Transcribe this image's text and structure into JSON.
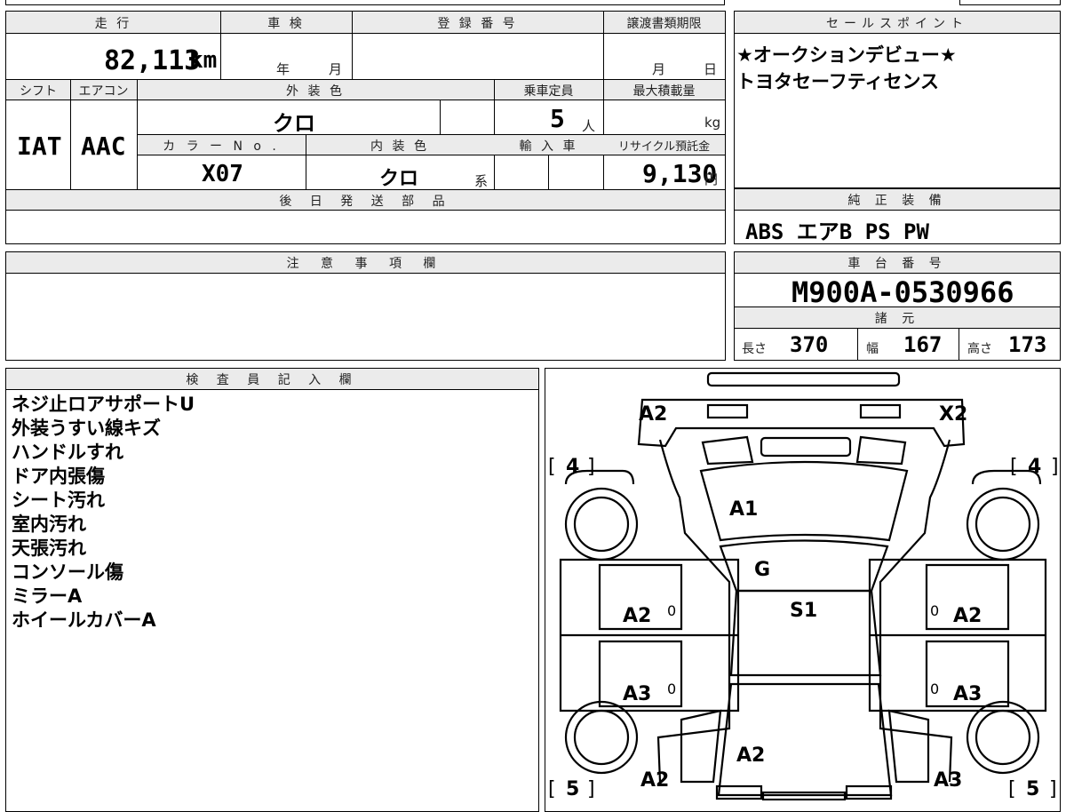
{
  "header": {
    "mileage_label": "走 行",
    "shaken_label": "車 検",
    "reg_no_label": "登 録 番 号",
    "transfer_deadline_label": "譲渡書類期限",
    "sales_points_label": "セールスポイント"
  },
  "mileage": {
    "value": "82,113",
    "unit": "km"
  },
  "shaken": {
    "year_unit": "年",
    "month_unit": "月"
  },
  "transfer_deadline": {
    "month_unit": "月",
    "day_unit": "日"
  },
  "row2": {
    "shift_label": "シフト",
    "aircon_label": "エアコン",
    "exterior_label": "外 装 色",
    "capacity_label": "乗車定員",
    "max_load_label": "最大積載量",
    "shift_value": "IAT",
    "aircon_value": "AAC",
    "exterior_value": "クロ",
    "capacity_value": "5",
    "capacity_unit": "人",
    "load_unit": "kg",
    "color_no_label": "カ ラ ー N o .",
    "interior_label": "内 装 色",
    "import_label": "輸 入 車",
    "recycle_label": "リサイクル預託金",
    "color_no_value": "X07",
    "interior_value": "クロ",
    "interior_suffix": "系",
    "recycle_value": "9,130",
    "recycle_unit": "円"
  },
  "later_parts_label": "後 日 発 送 部 品",
  "sales_points": [
    "★オークションデビュー★",
    "トヨタセーフティセンス"
  ],
  "standard_equipment": {
    "label": "純 正 装 備",
    "value": "ABS エアB PS PW"
  },
  "caution_label": "注 意 事 項 欄",
  "chassis": {
    "label": "車 台 番 号",
    "value": "M900A-0530966"
  },
  "specs": {
    "label": "諸 元",
    "length_label": "長さ",
    "length_value": "370",
    "width_label": "幅",
    "width_value": "167",
    "height_label": "高さ",
    "height_value": "173"
  },
  "inspector": {
    "label": "検 査 員 記 入 欄",
    "notes": [
      "ネジ止ロアサポートU",
      "外装うすい線キズ",
      "ハンドルすれ",
      "ドア内張傷",
      "シート汚れ",
      "室内汚れ",
      "天張汚れ",
      "コンソール傷",
      "ミラーA",
      "ホイールカバーA"
    ]
  },
  "diagram": {
    "marks": {
      "front_left": "A2",
      "front_right": "X2",
      "hood": "A1",
      "windshield": "G",
      "roof": "S1",
      "front_door_left": "A2",
      "front_door_right": "A2",
      "rear_door_left": "A3",
      "rear_door_right": "A3",
      "rear_window": "A2",
      "rear_quarter_left": "A2",
      "rear_quarter_right": "A3"
    },
    "tire_front_left": "4",
    "tire_front_right": "4",
    "tire_rear_left": "5",
    "tire_rear_right": "5",
    "door_zero": "0"
  }
}
